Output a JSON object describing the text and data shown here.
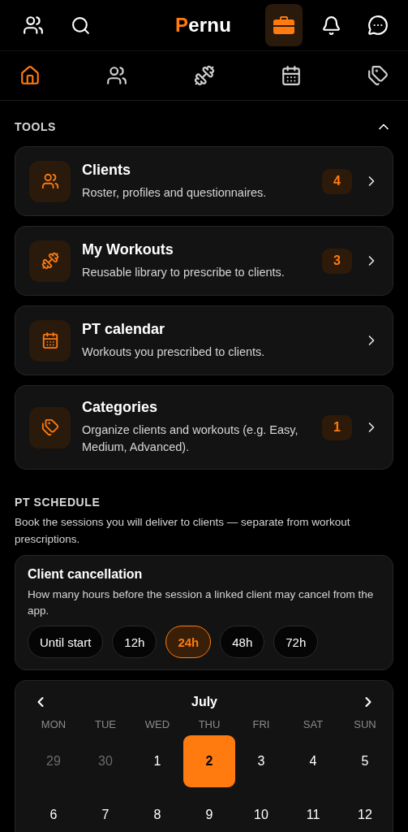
{
  "header": {
    "logo_initial": "P",
    "logo_rest": "ernu",
    "toolbox_active": true
  },
  "nav_tabs": [
    {
      "kind": "home",
      "selected": true
    },
    {
      "kind": "group",
      "selected": false
    },
    {
      "kind": "dumbbell",
      "selected": false
    },
    {
      "kind": "calendar",
      "selected": false
    },
    {
      "kind": "tags",
      "selected": false
    }
  ],
  "tools": {
    "title": "TOOLS",
    "expanded": true,
    "items": [
      {
        "kind": "group",
        "title": "Clients",
        "description": "Roster, profiles and questionnaires.",
        "count": "4"
      },
      {
        "kind": "dumbbell",
        "title": "My Workouts",
        "description": "Reusable library to prescribe to clients.",
        "count": "3"
      },
      {
        "kind": "calendar",
        "title": "PT calendar",
        "description": "Workouts you prescribed to clients."
      },
      {
        "kind": "tags",
        "title": "Categories",
        "description": "Organize clients and workouts (e.g. Easy, Medium, Advanced).",
        "count": "1"
      }
    ]
  },
  "schedule": {
    "title": "PT SCHEDULE",
    "description": "Book the sessions you will deliver to clients — separate from workout prescriptions.",
    "cancellation": {
      "title": "Client cancellation",
      "description": "How many hours before the session a linked client may cancel from the app.",
      "options": [
        {
          "label": "Until start",
          "selected": false
        },
        {
          "label": "12h",
          "selected": false
        },
        {
          "label": "24h",
          "selected": true
        },
        {
          "label": "48h",
          "selected": false
        },
        {
          "label": "72h",
          "selected": false
        }
      ]
    },
    "calendar": {
      "month": "July",
      "weekdays": [
        "MON",
        "TUE",
        "WED",
        "THU",
        "FRI",
        "SAT",
        "SUN"
      ],
      "days": [
        {
          "label": "29",
          "outside": true,
          "selected": false
        },
        {
          "label": "30",
          "outside": true,
          "selected": false
        },
        {
          "label": "1",
          "outside": false,
          "selected": false
        },
        {
          "label": "2",
          "outside": false,
          "selected": true
        },
        {
          "label": "3",
          "outside": false,
          "selected": false
        },
        {
          "label": "4",
          "outside": false,
          "selected": false
        },
        {
          "label": "5",
          "outside": false,
          "selected": false
        },
        {
          "label": "6",
          "outside": false,
          "selected": false
        },
        {
          "label": "7",
          "outside": false,
          "selected": false
        },
        {
          "label": "8",
          "outside": false,
          "selected": false
        },
        {
          "label": "9",
          "outside": false,
          "selected": false
        },
        {
          "label": "10",
          "outside": false,
          "selected": false
        },
        {
          "label": "11",
          "outside": false,
          "selected": false
        },
        {
          "label": "12",
          "outside": false,
          "selected": false
        }
      ]
    }
  }
}
